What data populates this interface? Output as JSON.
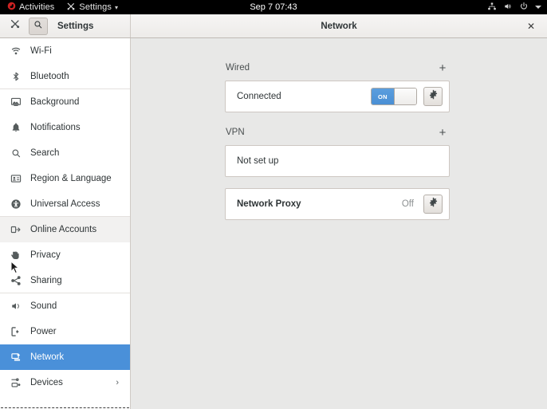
{
  "topbar": {
    "activities": {
      "label": "Activities",
      "icon": "fedora-logo-icon"
    },
    "app_menu": {
      "label": "Settings",
      "icon": "settings-tools-icon",
      "arrow": "▾"
    },
    "clock": "Sep 7  07:43",
    "status_icons": [
      "network-wired-icon",
      "volume-icon",
      "power-icon"
    ],
    "status_arrow": "▾"
  },
  "headerbar": {
    "app_icon": "settings-tools-icon",
    "search_icon": "search-icon",
    "sidebar_title": "Settings",
    "title": "Network",
    "close_label": "✕"
  },
  "sidebar": {
    "items": [
      {
        "label": "Wi-Fi",
        "icon": "wifi-icon",
        "state": "normal",
        "separator_after": false
      },
      {
        "label": "Bluetooth",
        "icon": "bluetooth-icon",
        "state": "normal",
        "separator_after": true
      },
      {
        "label": "Background",
        "icon": "background-icon",
        "state": "normal",
        "separator_after": false
      },
      {
        "label": "Notifications",
        "icon": "bell-icon",
        "state": "normal",
        "separator_after": false
      },
      {
        "label": "Search",
        "icon": "search-icon",
        "state": "normal",
        "separator_after": false
      },
      {
        "label": "Region & Language",
        "icon": "region-language-icon",
        "state": "normal",
        "separator_after": false
      },
      {
        "label": "Universal Access",
        "icon": "universal-access-icon",
        "state": "normal",
        "separator_after": true
      },
      {
        "label": "Online Accounts",
        "icon": "online-accounts-icon",
        "state": "hover",
        "separator_after": false
      },
      {
        "label": "Privacy",
        "icon": "privacy-hand-icon",
        "state": "normal",
        "separator_after": false
      },
      {
        "label": "Sharing",
        "icon": "sharing-icon",
        "state": "normal",
        "separator_after": true
      },
      {
        "label": "Sound",
        "icon": "sound-icon",
        "state": "normal",
        "separator_after": false
      },
      {
        "label": "Power",
        "icon": "power-plug-icon",
        "state": "normal",
        "separator_after": false
      },
      {
        "label": "Network",
        "icon": "network-icon",
        "state": "selected",
        "separator_after": false
      },
      {
        "label": "Devices",
        "icon": "devices-icon",
        "state": "normal",
        "separator_after": false,
        "chevron": "›"
      }
    ]
  },
  "panel": {
    "sections": [
      {
        "title": "Wired",
        "add_label": "+",
        "rows": [
          {
            "label": "Connected",
            "bold": false,
            "switch": {
              "present": true,
              "state_label": "ON",
              "on": true
            },
            "gear": true,
            "dim_text": null
          }
        ]
      },
      {
        "title": "VPN",
        "add_label": "+",
        "rows": [
          {
            "label": "Not set up",
            "bold": false,
            "switch": {
              "present": false
            },
            "gear": false,
            "dim_text": null
          }
        ]
      }
    ],
    "proxy_card": {
      "label": "Network Proxy",
      "bold": true,
      "dim_text": "Off",
      "gear": true
    }
  },
  "colors": {
    "selection_blue": "#4a90d9",
    "switch_blue": "#4a8fd4",
    "sidebar_bg": "#ffffff",
    "content_bg": "#e8e8e7",
    "headerbar_bg": "#f0eeec",
    "topbar_bg": "#000000",
    "card_border": "#cdc7c2",
    "text": "#2e3436",
    "dim_text": "#8d9192"
  }
}
